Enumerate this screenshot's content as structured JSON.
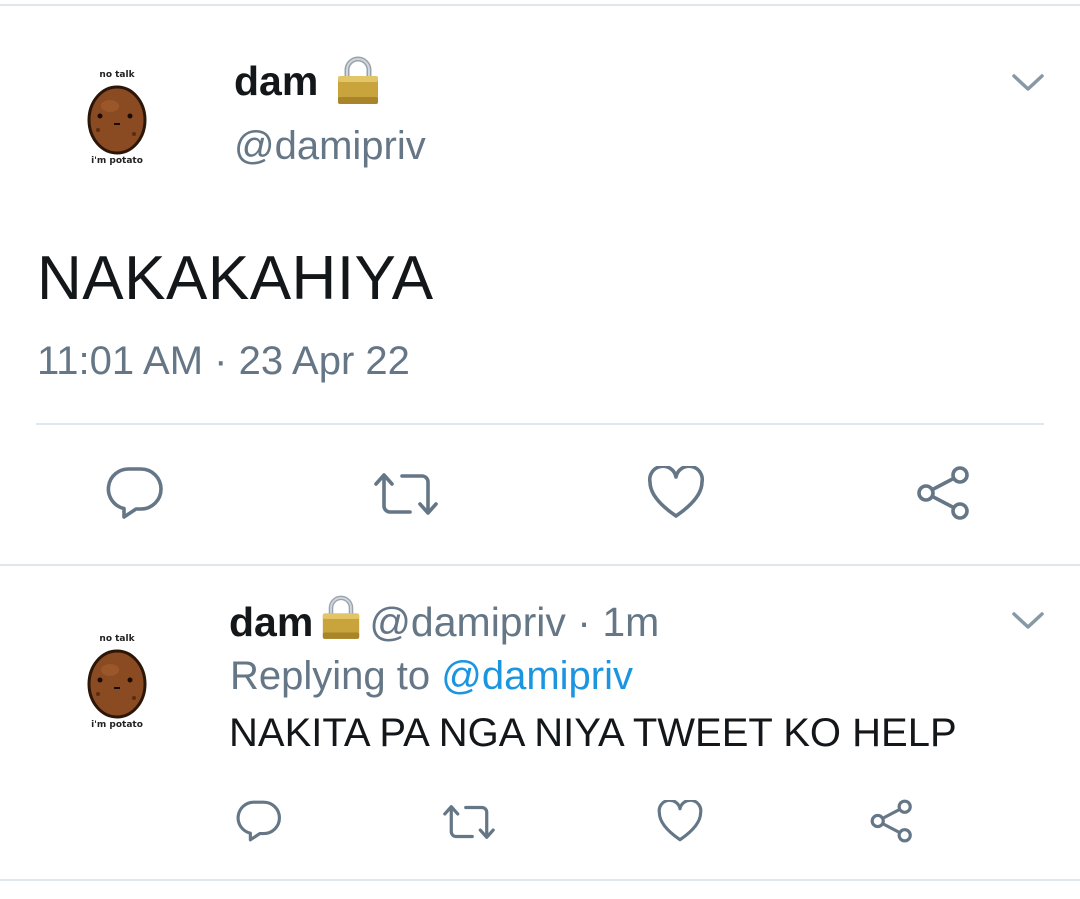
{
  "main_tweet": {
    "display_name": "dam",
    "handle": "@damipriv",
    "text": "NAKAKAHIYA",
    "time": "11:01 AM",
    "separator": "·",
    "date": "23 Apr 22",
    "avatar": {
      "top_text": "no talk",
      "bottom_text": "i'm potato"
    }
  },
  "reply_tweet": {
    "display_name": "dam",
    "handle": "@damipriv",
    "separator": "·",
    "age": "1m",
    "replying_to_label": "Replying to",
    "replying_to_handle": "@damipriv",
    "text": "NAKITA PA NGA NIYA TWEET KO HELP",
    "avatar": {
      "top_text": "no talk",
      "bottom_text": "i'm potato"
    }
  },
  "icons": {
    "lock": "lock-icon",
    "menu": "chevron-down-icon",
    "reply": "reply-icon",
    "retweet": "retweet-icon",
    "like": "heart-icon",
    "share": "share-icon"
  },
  "colors": {
    "text": "#14171a",
    "secondary": "#657786",
    "link": "#1b95e0",
    "divider": "#e1e8ed"
  }
}
